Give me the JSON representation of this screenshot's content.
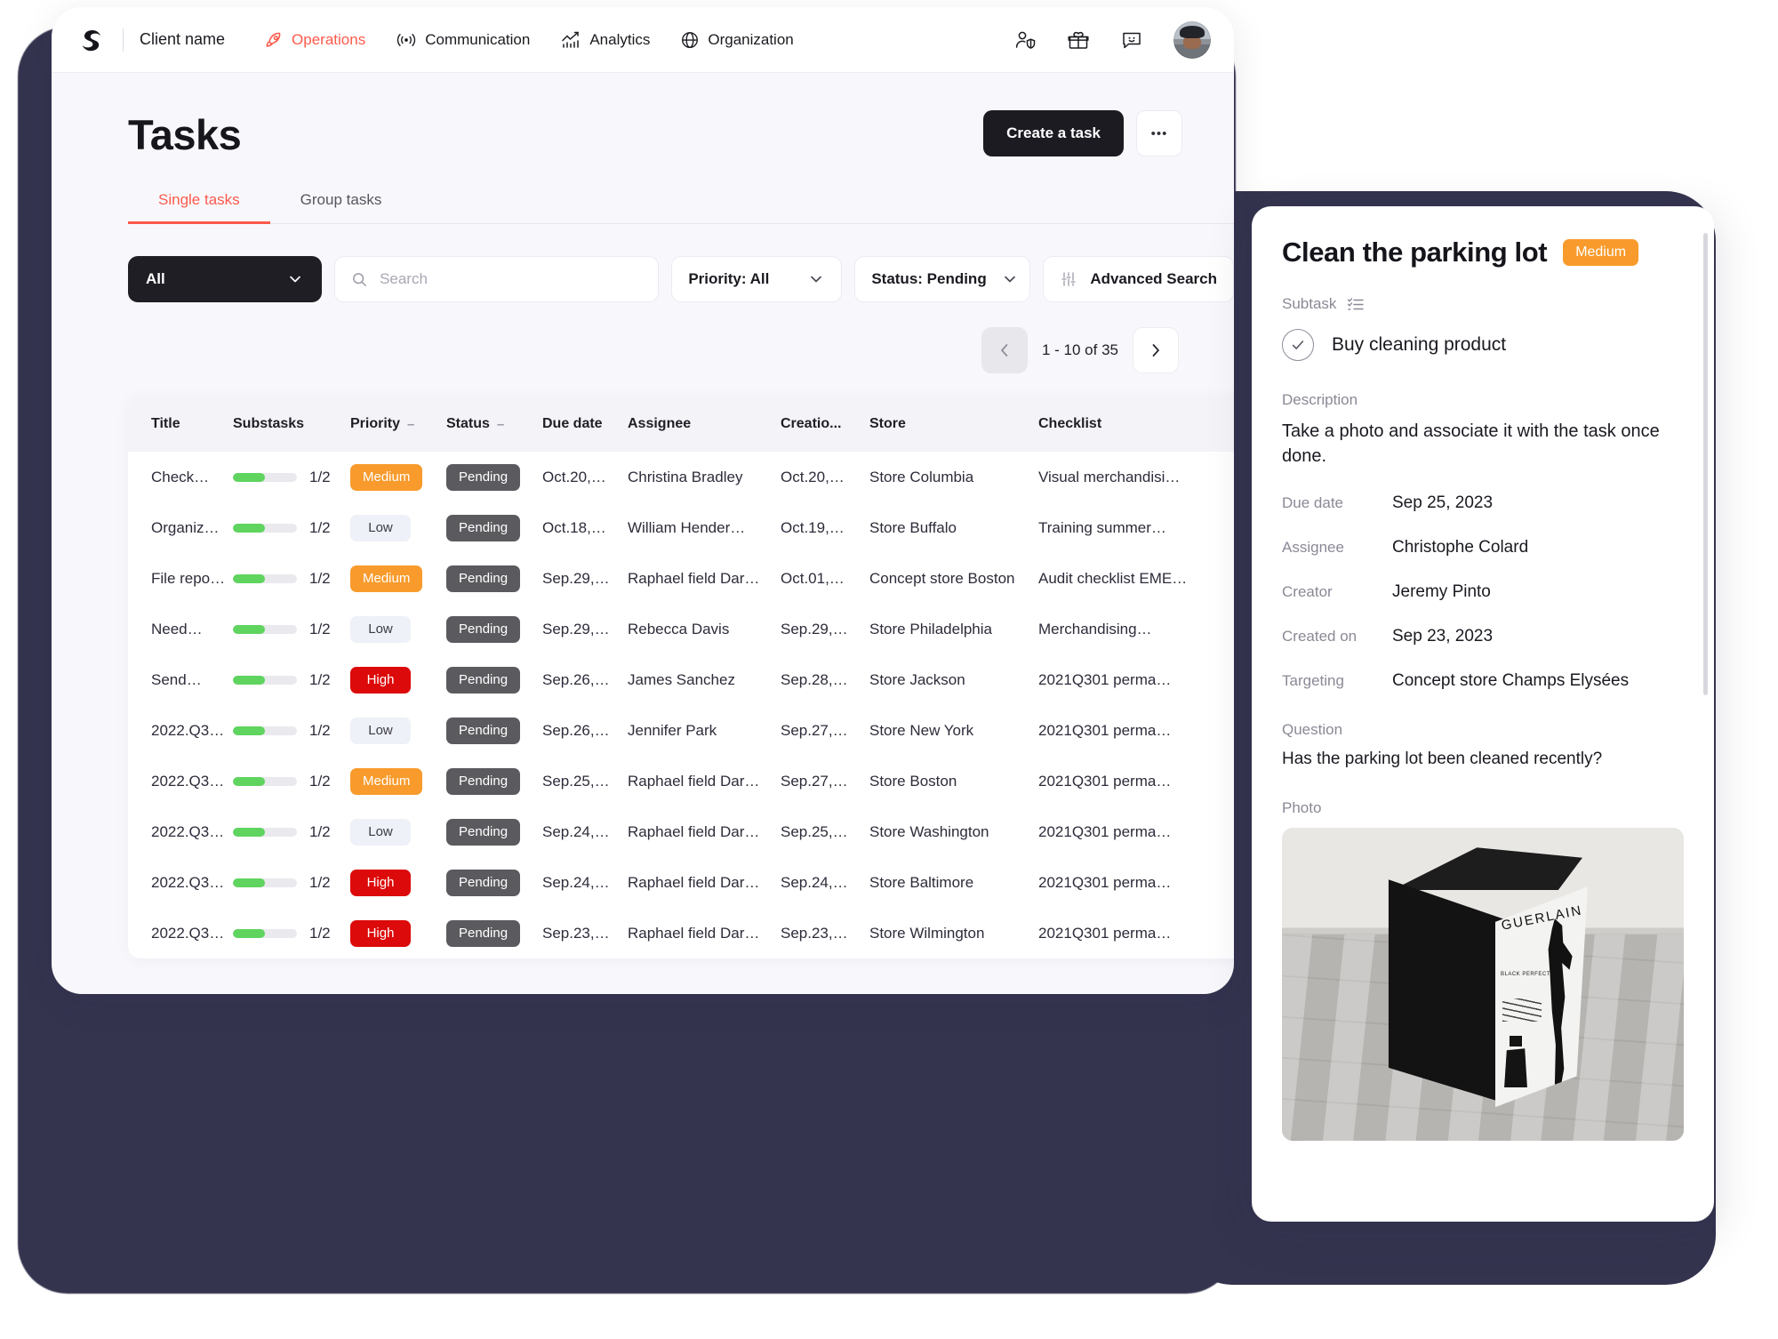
{
  "topnav": {
    "logo": "logo-mark",
    "client_name": "Client name",
    "items": [
      {
        "label": "Operations",
        "icon": "rocket-icon",
        "active": true
      },
      {
        "label": "Communication",
        "icon": "broadcast-icon",
        "active": false
      },
      {
        "label": "Analytics",
        "icon": "chart-icon",
        "active": false
      },
      {
        "label": "Organization",
        "icon": "globe-icon",
        "active": false
      }
    ],
    "right_icons": [
      "user-shield-icon",
      "gift-icon",
      "chat-smile-icon",
      "avatar"
    ]
  },
  "page": {
    "title": "Tasks",
    "create_button": "Create a task",
    "more_button": "•••"
  },
  "tabs": [
    {
      "label": "Single tasks",
      "active": true
    },
    {
      "label": "Group tasks",
      "active": false
    }
  ],
  "filters": {
    "scope_select": "All",
    "search_placeholder": "Search",
    "search_value": "",
    "priority_select": "Priority: All",
    "status_select": "Status: Pending",
    "advanced_search": "Advanced Search"
  },
  "pagination": {
    "prev": "‹",
    "next": "›",
    "label": "1 - 10 of 35"
  },
  "table": {
    "columns": [
      "Title",
      "Substasks",
      "Priority",
      "Status",
      "Due date",
      "Assignee",
      "Creatio...",
      "Store",
      "Checklist"
    ],
    "rows": [
      {
        "title": "Check…",
        "substasks": "1/2",
        "progress": 50,
        "priority": "Medium",
        "status": "Pending",
        "due": "Oct.20,…",
        "assignee": "Christina Bradley",
        "creation": "Oct.20,…",
        "store": "Store Columbia",
        "checklist": "Visual merchandisi…"
      },
      {
        "title": "Organiz…",
        "substasks": "1/2",
        "progress": 50,
        "priority": "Low",
        "status": "Pending",
        "due": "Oct.18,…",
        "assignee": "William Hender…",
        "creation": "Oct.19,…",
        "store": "Store Buffalo",
        "checklist": "Training summer…"
      },
      {
        "title": "File repo…",
        "substasks": "1/2",
        "progress": 50,
        "priority": "Medium",
        "status": "Pending",
        "due": "Sep.29,…",
        "assignee": "Raphael field Dar…",
        "creation": "Oct.01,…",
        "store": "Concept store Boston",
        "checklist": "Audit checklist EME…"
      },
      {
        "title": "Need…",
        "substasks": "1/2",
        "progress": 50,
        "priority": "Low",
        "status": "Pending",
        "due": "Sep.29,…",
        "assignee": "Rebecca Davis",
        "creation": "Sep.29,…",
        "store": "Store Philadelphia",
        "checklist": "Merchandising…"
      },
      {
        "title": "Send…",
        "substasks": "1/2",
        "progress": 50,
        "priority": "High",
        "status": "Pending",
        "due": "Sep.26,…",
        "assignee": "James Sanchez",
        "creation": "Sep.28,…",
        "store": "Store Jackson",
        "checklist": "2021Q301 perma…"
      },
      {
        "title": "2022.Q3…",
        "substasks": "1/2",
        "progress": 50,
        "priority": "Low",
        "status": "Pending",
        "due": "Sep.26,…",
        "assignee": "Jennifer Park",
        "creation": "Sep.27,…",
        "store": "Store New York",
        "checklist": "2021Q301 perma…"
      },
      {
        "title": "2022.Q3…",
        "substasks": "1/2",
        "progress": 50,
        "priority": "Medium",
        "status": "Pending",
        "due": "Sep.25,…",
        "assignee": "Raphael field Dar…",
        "creation": "Sep.27,…",
        "store": "Store Boston",
        "checklist": "2021Q301 perma…"
      },
      {
        "title": "2022.Q3…",
        "substasks": "1/2",
        "progress": 50,
        "priority": "Low",
        "status": "Pending",
        "due": "Sep.24,…",
        "assignee": "Raphael field Dar…",
        "creation": "Sep.25,…",
        "store": "Store Washington",
        "checklist": "2021Q301 perma…"
      },
      {
        "title": "2022.Q3…",
        "substasks": "1/2",
        "progress": 50,
        "priority": "High",
        "status": "Pending",
        "due": "Sep.24,…",
        "assignee": "Raphael field Dar…",
        "creation": "Sep.24,…",
        "store": "Store Baltimore",
        "checklist": "2021Q301 perma…"
      },
      {
        "title": "2022.Q3…",
        "substasks": "1/2",
        "progress": 50,
        "priority": "High",
        "status": "Pending",
        "due": "Sep.23,…",
        "assignee": "Raphael field Dar…",
        "creation": "Sep.23,…",
        "store": "Store Wilmington",
        "checklist": "2021Q301 perma…"
      }
    ]
  },
  "detail": {
    "title": "Clean the parking lot",
    "priority_badge": "Medium",
    "subtask_label": "Subtask",
    "subtask_name": "Buy cleaning product",
    "description_label": "Description",
    "description": "Take a photo and associate it with the task once done.",
    "due_date_label": "Due date",
    "due_date": "Sep 25, 2023",
    "assignee_label": "Assignee",
    "assignee": "Christophe Colard",
    "creator_label": "Creator",
    "creator": "Jeremy Pinto",
    "created_on_label": "Created on",
    "created_on": "Sep 23, 2023",
    "targeting_label": "Targeting",
    "targeting": "Concept store Champs Elysées",
    "question_label": "Question",
    "question": "Has the parking lot been cleaned recently?",
    "photo_label": "Photo",
    "photo_alt": "Black and white GUERLAIN perfume box on a wooden floor",
    "photo_brand": "GUERLAIN",
    "photo_subtitle": "BLACK PERFECTO"
  },
  "colors": {
    "accent": "#fb5a4c",
    "dark": "#1c1b22",
    "high": "#dc0a0a",
    "medium": "#f89b2c",
    "low": "#eef1f7",
    "pending": "#5b5a5e",
    "progress": "#5fd45f",
    "frame": "#35344f"
  }
}
